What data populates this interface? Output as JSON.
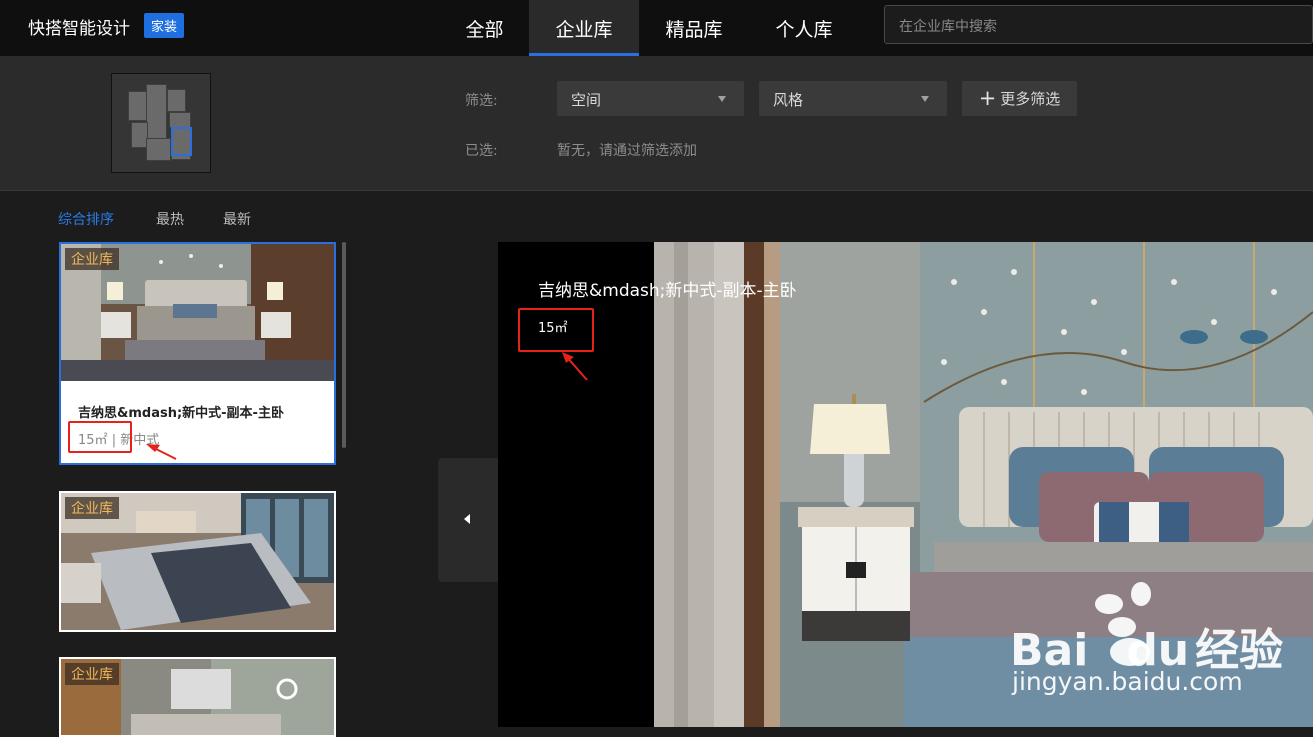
{
  "header": {
    "brand": "快搭智能设计",
    "badge": "家装",
    "tabs": [
      {
        "label": "全部",
        "active": false
      },
      {
        "label": "企业库",
        "active": true
      },
      {
        "label": "精品库",
        "active": false
      },
      {
        "label": "个人库",
        "active": false
      }
    ],
    "search_placeholder": "在企业库中搜索"
  },
  "filters": {
    "filter_label": "筛选:",
    "space_select": "空间",
    "style_select": "风格",
    "more_label": "更多筛选",
    "selected_label": "已选:",
    "selected_value": "暂无，请通过筛选添加"
  },
  "sort": {
    "tabs": [
      {
        "label": "综合排序",
        "active": true
      },
      {
        "label": "最热",
        "active": false
      },
      {
        "label": "最新",
        "active": false
      }
    ]
  },
  "cards": [
    {
      "tag": "企业库",
      "title": "吉纳思&mdash;新中式-副本-主卧",
      "area": "15㎡",
      "style": "新中式",
      "selected": true
    },
    {
      "tag": "企业库"
    },
    {
      "tag": "企业库"
    }
  ],
  "preview": {
    "title": "吉纳思&mdash;新中式-副本-主卧",
    "area": "15㎡"
  },
  "watermark": {
    "logo_text": "Bai",
    "logo_text2": "du",
    "logo_cn": "经验",
    "url": "jingyan.baidu.com"
  },
  "colors": {
    "accent": "#2a6fe0",
    "annotation_red": "#e5231b",
    "tag_text": "#f0b85c"
  }
}
